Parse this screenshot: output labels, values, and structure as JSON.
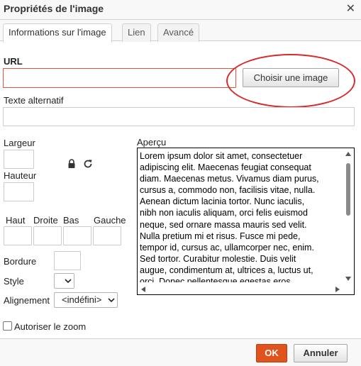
{
  "dialog": {
    "title": "Propriétés de l'image",
    "close_glyph": "✕"
  },
  "tabs": [
    {
      "label": "Informations sur l'image",
      "active": true
    },
    {
      "label": "Lien",
      "active": false
    },
    {
      "label": "Avancé",
      "active": false
    }
  ],
  "info": {
    "url_label": "URL",
    "url_value": "",
    "choose_image_label": "Choisir une image",
    "alt_label": "Texte alternatif",
    "alt_value": "",
    "width_label": "Largeur",
    "width_value": "",
    "height_label": "Hauteur",
    "height_value": "",
    "lock_icon": "lock-icon",
    "reset_icon": "reset-size-icon",
    "spacing": {
      "top_label": "Haut",
      "right_label": "Droite",
      "bottom_label": "Bas",
      "left_label": "Gauche",
      "top_value": "",
      "right_value": "",
      "bottom_value": "",
      "left_value": ""
    },
    "border_label": "Bordure",
    "border_value": "",
    "style_label": "Style",
    "style_value": "",
    "alignment_label": "Alignement",
    "alignment_value": "<indéfini>",
    "zoom_label": "Autoriser le zoom",
    "zoom_checked": false
  },
  "preview": {
    "label": "Aperçu",
    "lines": [
      "Lorem ipsum dolor sit amet, consectetuer",
      "adipiscing elit. Maecenas feugiat consequat",
      "diam. Maecenas metus. Vivamus diam purus,",
      "cursus a, commodo non, facilisis vitae, nulla.",
      "Aenean dictum lacinia tortor. Nunc iaculis,",
      "nibh non iaculis aliquam, orci felis euismod",
      "neque, sed ornare massa mauris sed velit.",
      "Nulla pretium mi et risus. Fusce mi pede,",
      "tempor id, cursus ac, ullamcorper nec, enim.",
      "Sed tortor. Curabitur molestie. Duis velit",
      "augue, condimentum at, ultrices a, luctus ut,",
      "orci. Donec pellentesque egestas eros."
    ]
  },
  "footer": {
    "ok_label": "OK",
    "cancel_label": "Annuler"
  },
  "colors": {
    "accent": "#e0531d",
    "highlight": "#d62b2b",
    "error_border": "#e0533e"
  }
}
